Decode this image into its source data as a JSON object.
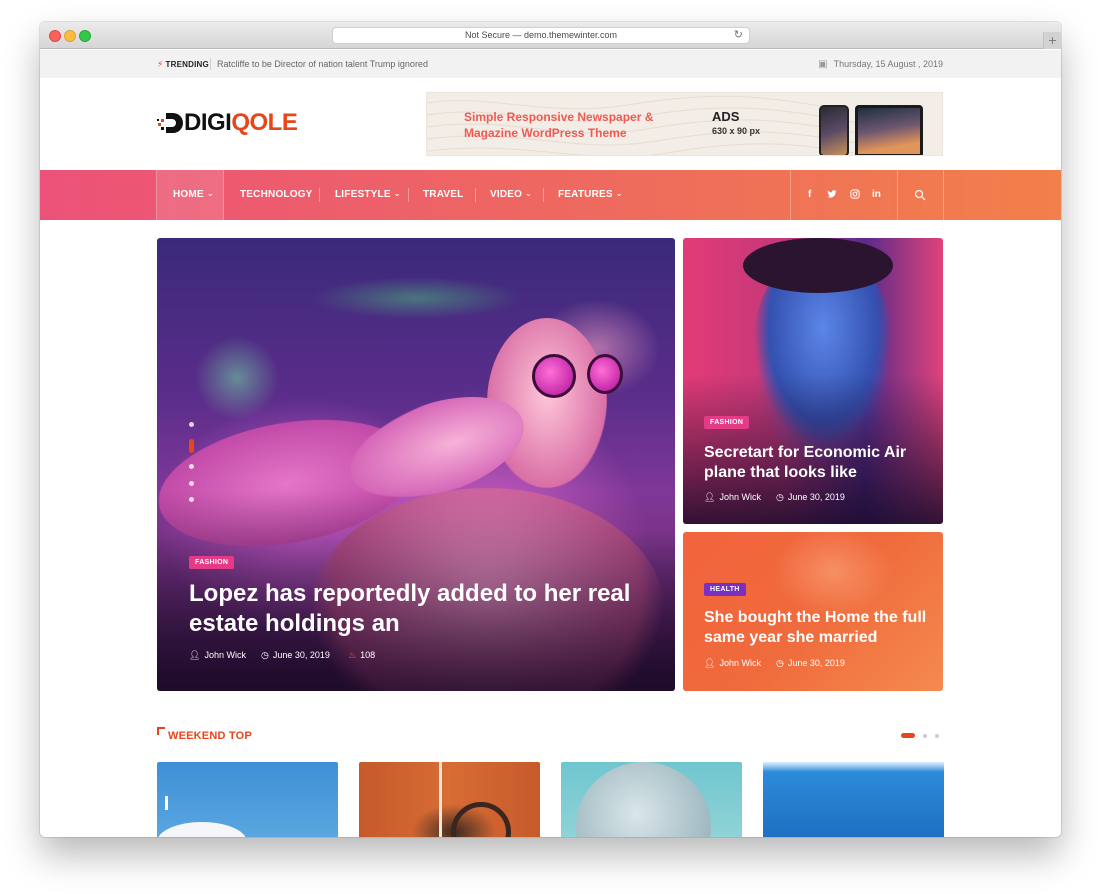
{
  "browser": {
    "url_text": "Not Secure — demo.themewinter.com",
    "reload_icon": "reload-icon",
    "new_tab_label": "+"
  },
  "topbar": {
    "trending_label": "TRENDING",
    "trending_text": "Ratcliffe to be Director of nation talent Trump ignored",
    "date": "Thursday, 15 August , 2019"
  },
  "logo": {
    "part1": "DIGI",
    "part2": "QOLE"
  },
  "ad": {
    "text": "Simple Responsive Newspaper & Magazine WordPress Theme",
    "title": "ADS",
    "size": "630 x 90 px"
  },
  "nav": {
    "items": [
      {
        "label": "HOME",
        "dropdown": true
      },
      {
        "label": "TECHNOLOGY",
        "dropdown": false
      },
      {
        "label": "LIFESTYLE",
        "dropdown": true
      },
      {
        "label": "TRAVEL",
        "dropdown": false
      },
      {
        "label": "VIDEO",
        "dropdown": true
      },
      {
        "label": "FEATURES",
        "dropdown": true
      }
    ],
    "social": [
      "f",
      "twitter-icon",
      "instagram-icon",
      "in"
    ],
    "search_icon": "search-icon"
  },
  "hero": {
    "main": {
      "category": "FASHION",
      "title": "Lopez has reportedly added to her real estate holdings an",
      "author": "John Wick",
      "date": "June 30, 2019",
      "views": "108"
    },
    "side1": {
      "category": "FASHION",
      "title": "Secretart for Economic Air plane that looks like",
      "author": "John Wick",
      "date": "June 30, 2019"
    },
    "side2": {
      "category": "HEALTH",
      "title": "She bought the Home the full same year she married",
      "author": "John Wick",
      "date": "June 30, 2019"
    },
    "slider_active_index": 1
  },
  "weekend": {
    "title": "WEEKEND TOP"
  },
  "colors": {
    "accent": "#e8451a",
    "nav_start": "#ec5279",
    "nav_end": "#f2804a",
    "fashion": "#e43b87",
    "health": "#7b2fbf"
  }
}
